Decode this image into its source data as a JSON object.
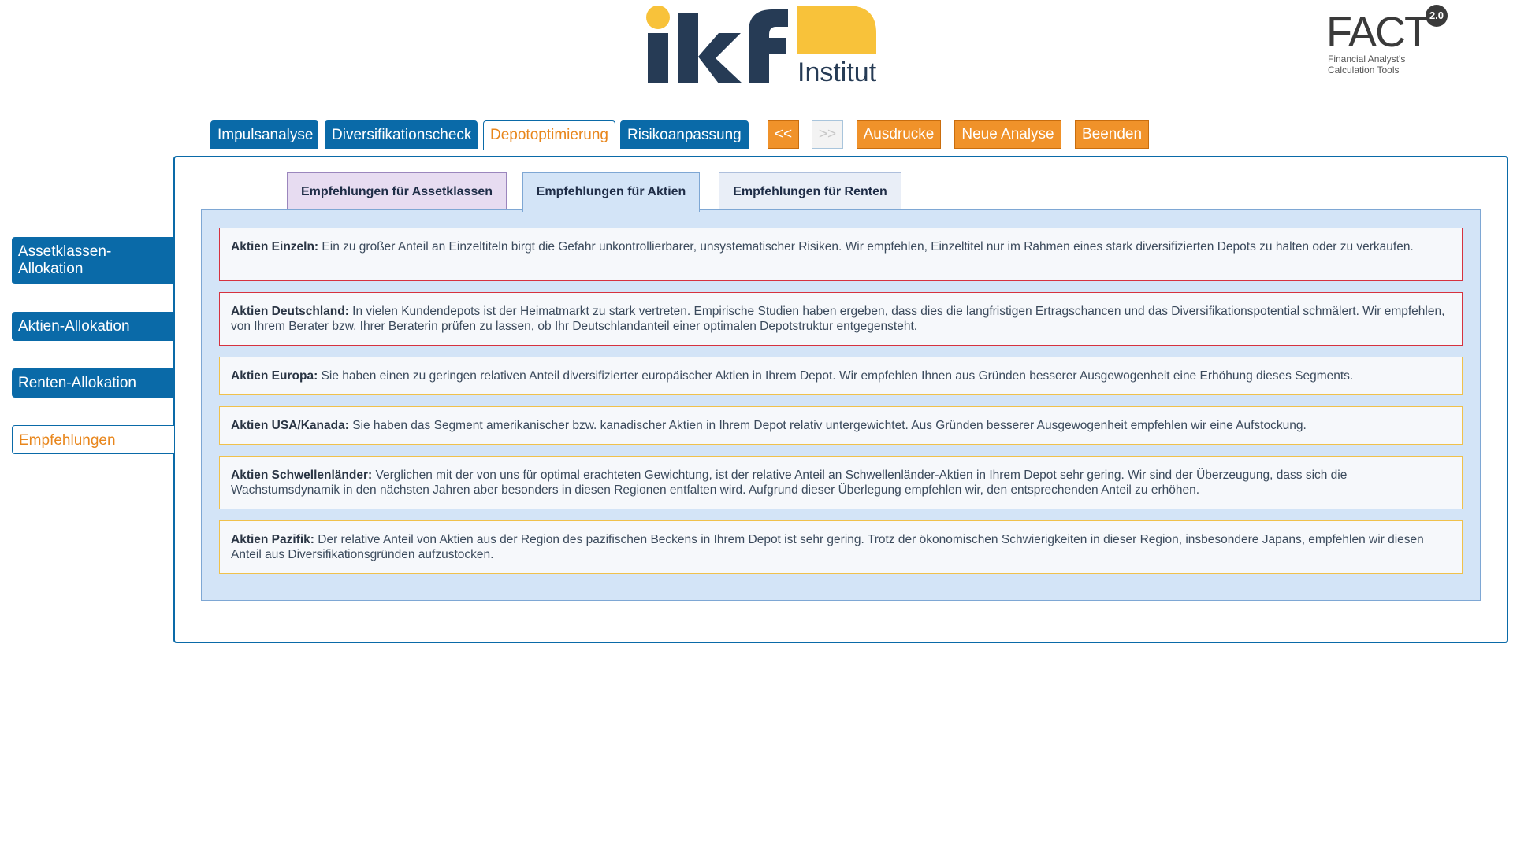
{
  "logo": {
    "institut_text": "Institut",
    "fact_text": "FACT",
    "fact_version": "2.0",
    "fact_sub1": "Financial Analyst's",
    "fact_sub2": "Calculation Tools"
  },
  "top_nav": {
    "tabs": [
      {
        "label": "Impulsanalyse"
      },
      {
        "label": "Diversifikationscheck"
      },
      {
        "label": "Depotoptimierung",
        "active": true
      },
      {
        "label": "Risikoanpassung"
      }
    ],
    "prev_label": "<<",
    "next_label": ">>",
    "print_label": "Ausdrucke",
    "new_label": "Neue Analyse",
    "exit_label": "Beenden"
  },
  "side_nav": {
    "items": [
      {
        "label": "Assetklassen-Allokation"
      },
      {
        "label": "Aktien-Allokation"
      },
      {
        "label": "Renten-Allokation"
      },
      {
        "label": "Empfehlungen",
        "active": true
      }
    ]
  },
  "sub_tabs": [
    {
      "label": "Empfehlungen für Assetklassen"
    },
    {
      "label": "Empfehlungen für Aktien",
      "active": true
    },
    {
      "label": "Empfehlungen für Renten"
    }
  ],
  "recommendations": [
    {
      "title": "Aktien Einzeln:",
      "text": "Ein zu großer Anteil an Einzeltiteln birgt die Gefahr unkontrollierbarer, unsystematischer Risiken. Wir empfehlen, Einzeltitel nur im Rahmen eines stark diversifizierten Depots zu halten oder zu verkaufen.",
      "level": "warning"
    },
    {
      "title": "Aktien Deutschland:",
      "text": "In vielen Kundendepots ist der Heimatmarkt zu stark vertreten. Empirische Studien haben ergeben, dass dies die langfristigen Ertragschancen und das Diversifikationspotential schmälert. Wir empfehlen, von Ihrem Berater bzw. Ihrer Beraterin prüfen zu lassen, ob Ihr Deutschlandanteil einer optimalen Depotstruktur entgegensteht.",
      "level": "warning"
    },
    {
      "title": "Aktien Europa:",
      "text": "Sie haben einen zu geringen relativen Anteil diversifizierter europäischer Aktien in Ihrem Depot. Wir empfehlen Ihnen aus Gründen besserer Ausgewogenheit eine Erhöhung dieses Segments.",
      "level": "info"
    },
    {
      "title": "Aktien USA/Kanada:",
      "text": "Sie haben das Segment amerikanischer bzw. kanadischer Aktien in Ihrem Depot relativ untergewichtet. Aus Gründen besserer Ausgewogenheit empfehlen wir eine Aufstockung.",
      "level": "info"
    },
    {
      "title": "Aktien Schwellenländer:",
      "text": "Verglichen mit der von uns für optimal erachteten Gewichtung, ist der relative Anteil an Schwellenländer-Aktien in Ihrem Depot sehr gering. Wir sind der Überzeugung, dass sich die Wachstumsdynamik in den nächsten Jahren aber besonders in diesen Regionen entfalten wird. Aufgrund dieser Überlegung empfehlen wir, den entsprechenden Anteil zu erhöhen.",
      "level": "info"
    },
    {
      "title": "Aktien Pazifik:",
      "text": "Der relative Anteil von Aktien aus der Region des pazifischen Beckens in Ihrem Depot ist sehr gering. Trotz der ökonomischen Schwierigkeiten in dieser Region, insbesondere Japans, empfehlen wir diesen Anteil aus Diversifikationsgründen aufzustocken.",
      "level": "info"
    }
  ],
  "colors": {
    "primary_blue": "#0a6aa8",
    "accent_orange": "#e8861c",
    "warning_border": "#d6323f",
    "info_border": "#f0c14b"
  }
}
